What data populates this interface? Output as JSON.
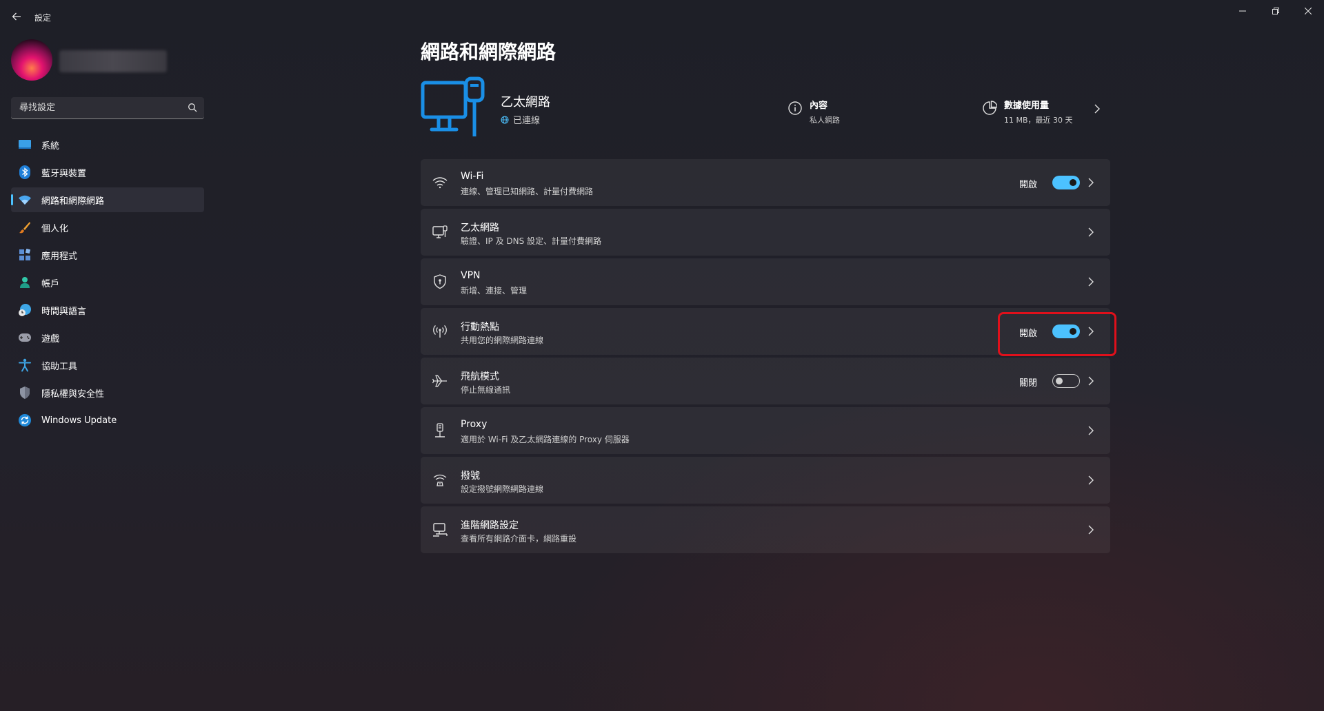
{
  "window": {
    "title": "設定",
    "back_icon": "back-arrow-icon",
    "controls": [
      "minimize-icon",
      "restore-icon",
      "close-icon"
    ]
  },
  "sidebar": {
    "search": {
      "placeholder": "尋找設定",
      "icon": "search-icon"
    },
    "items": [
      {
        "label": "系統",
        "icon": "system-icon",
        "active": false
      },
      {
        "label": "藍牙與裝置",
        "icon": "bluetooth-icon",
        "active": false
      },
      {
        "label": "網路和網際網路",
        "icon": "network-icon",
        "active": true
      },
      {
        "label": "個人化",
        "icon": "brush-icon",
        "active": false
      },
      {
        "label": "應用程式",
        "icon": "apps-icon",
        "active": false
      },
      {
        "label": "帳戶",
        "icon": "account-icon",
        "active": false
      },
      {
        "label": "時間與語言",
        "icon": "time-language-icon",
        "active": false
      },
      {
        "label": "遊戲",
        "icon": "gaming-icon",
        "active": false
      },
      {
        "label": "協助工具",
        "icon": "accessibility-icon",
        "active": false
      },
      {
        "label": "隱私權與安全性",
        "icon": "shield-icon",
        "active": false
      },
      {
        "label": "Windows Update",
        "icon": "windows-update-icon",
        "active": false
      }
    ]
  },
  "main": {
    "title": "網路和網際網路",
    "connection": {
      "name": "乙太網路",
      "status": "已連線",
      "properties": {
        "title": "內容",
        "subtitle": "私人網路"
      },
      "usage": {
        "title": "數據使用量",
        "subtitle": "11 MB，最近 30 天"
      }
    },
    "rows": [
      {
        "title": "Wi-Fi",
        "subtitle": "連線、管理已知網路、計量付費網路",
        "icon": "wifi-icon",
        "toggle": true,
        "state": "開啟"
      },
      {
        "title": "乙太網路",
        "subtitle": "驗證、IP 及 DNS 設定、計量付費網路",
        "icon": "ethernet-icon",
        "toggle": null,
        "state": ""
      },
      {
        "title": "VPN",
        "subtitle": "新增、連接、管理",
        "icon": "vpn-shield-icon",
        "toggle": null,
        "state": ""
      },
      {
        "title": "行動熱點",
        "subtitle": "共用您的網際網路連線",
        "icon": "hotspot-icon",
        "toggle": true,
        "state": "開啟"
      },
      {
        "title": "飛航模式",
        "subtitle": "停止無線通訊",
        "icon": "airplane-icon",
        "toggle": false,
        "state": "關閉"
      },
      {
        "title": "Proxy",
        "subtitle": "適用於 Wi-Fi 及乙太網路連線的 Proxy 伺服器",
        "icon": "proxy-icon",
        "toggle": null,
        "state": ""
      },
      {
        "title": "撥號",
        "subtitle": "設定撥號網際網路連線",
        "icon": "dialup-icon",
        "toggle": null,
        "state": ""
      },
      {
        "title": "進階網路設定",
        "subtitle": "查看所有網路介面卡，網路重設",
        "icon": "advanced-network-icon",
        "toggle": null,
        "state": ""
      }
    ]
  },
  "colors": {
    "accent": "#4cc2ff",
    "highlight": "#e0101b",
    "background": "#202028"
  }
}
